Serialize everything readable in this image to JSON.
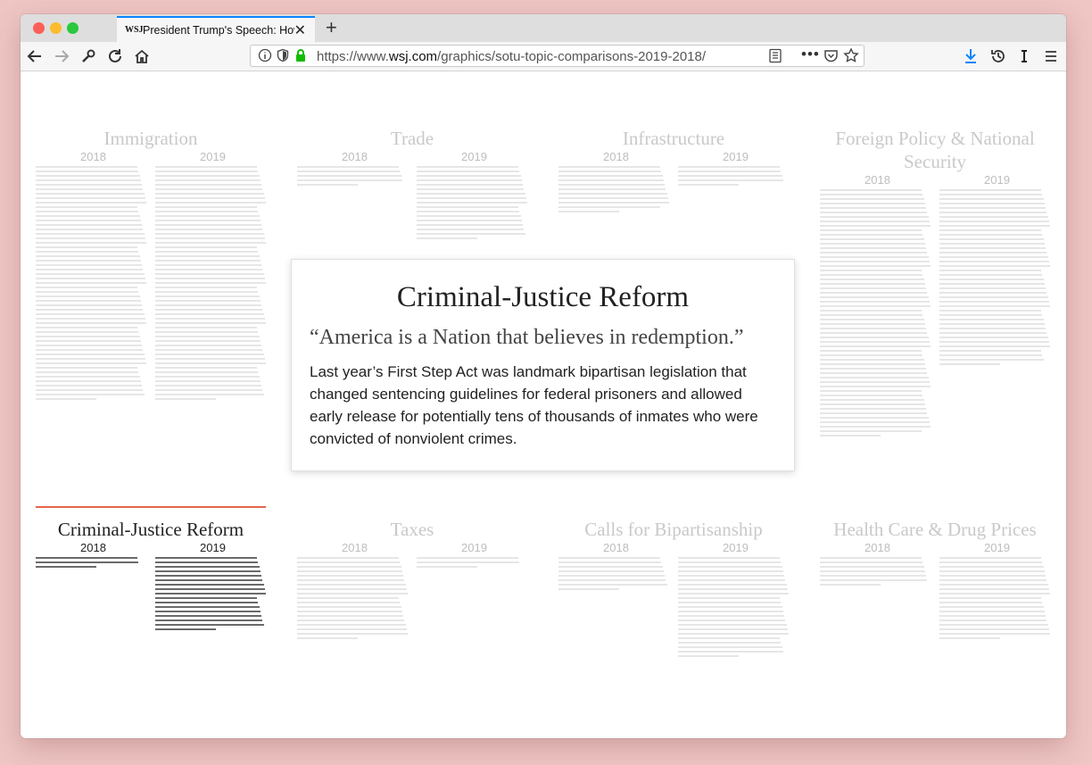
{
  "browser": {
    "tab_favicon": "WSJ",
    "tab_title": "President Trump's Speech: How",
    "tab_close": "✕",
    "new_tab": "+",
    "url_prefix": "https://www.",
    "url_domain": "wsj.com",
    "url_path": "/graphics/sotu-topic-comparisons-2019-2018/",
    "url_dots": "•••"
  },
  "sections": [
    {
      "title": "Immigration",
      "year_a": "2018",
      "year_b": "2019",
      "active": false
    },
    {
      "title": "Trade",
      "year_a": "2018",
      "year_b": "2019",
      "active": false
    },
    {
      "title": "Infrastructure",
      "year_a": "2018",
      "year_b": "2019",
      "active": false
    },
    {
      "title": "Foreign Policy & National Security",
      "year_a": "2018",
      "year_b": "2019",
      "active": false
    },
    {
      "title": "Criminal-Justice Reform",
      "year_a": "2018",
      "year_b": "2019",
      "active": true
    },
    {
      "title": "Taxes",
      "year_a": "2018",
      "year_b": "2019",
      "active": false
    },
    {
      "title": "Calls for Bipartisanship",
      "year_a": "2018",
      "year_b": "2019",
      "active": false
    },
    {
      "title": "Health Care & Drug Prices",
      "year_a": "2018",
      "year_b": "2019",
      "active": false
    }
  ],
  "popup": {
    "title": "Criminal-Justice Reform",
    "quote": "“America is a Nation that believes in redemption.”",
    "body": "Last year’s First Step Act was landmark bipartisan legislation that changed sentencing guidelines for federal prisoners and allowed early release for potentially tens of thousands of inmates who were convicted of nonviolent crimes."
  },
  "colors": {
    "accent": "#e2664a",
    "inactive_text": "#c9c9c9",
    "active_text": "#222222",
    "tab_highlight": "#0a84ff",
    "download_icon": "#0a84ff"
  }
}
